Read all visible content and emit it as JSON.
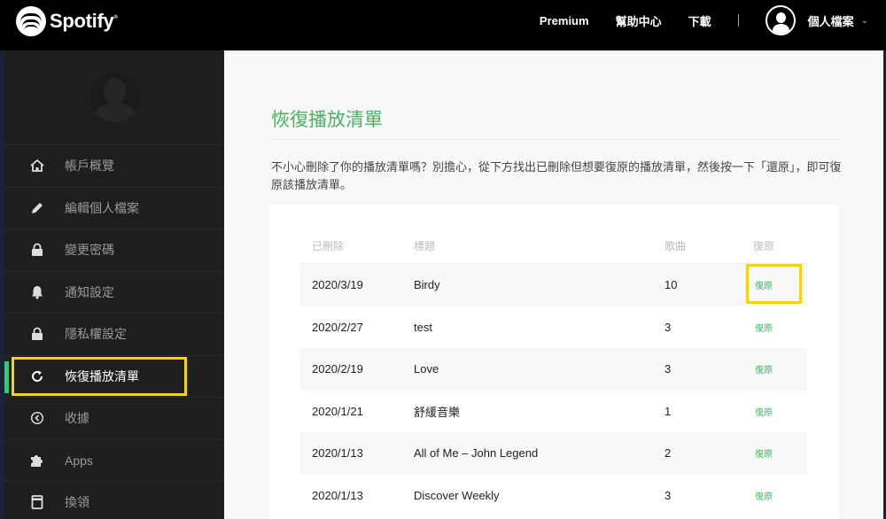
{
  "header": {
    "brand": "Spotify",
    "nav": [
      {
        "label": "Premium"
      },
      {
        "label": "幫助中心"
      },
      {
        "label": "下載"
      }
    ],
    "profile_label": "個人檔案",
    "profile_chevron": "⌄"
  },
  "sidebar": {
    "items": [
      {
        "label": "帳戶概覽",
        "icon": "home-icon",
        "glyph": "⌂"
      },
      {
        "label": "編輯個人檔案",
        "icon": "pencil-icon",
        "glyph": "✎"
      },
      {
        "label": "變更密碼",
        "icon": "lock-icon",
        "glyph": "🔒"
      },
      {
        "label": "通知設定",
        "icon": "bell-icon",
        "glyph": "🔔"
      },
      {
        "label": "隱私權設定",
        "icon": "lock-icon",
        "glyph": "🔒"
      },
      {
        "label": "恢復播放清單",
        "icon": "refresh-icon",
        "glyph": "⟳",
        "active": true
      },
      {
        "label": "收據",
        "icon": "clock-back-icon",
        "glyph": "⊙"
      },
      {
        "label": "Apps",
        "icon": "puzzle-icon",
        "glyph": "✚"
      },
      {
        "label": "換領",
        "icon": "card-icon",
        "glyph": "▭"
      }
    ]
  },
  "main": {
    "title": "恢復播放清單",
    "description": "不小心刪除了你的播放清單嗎？別擔心，從下方找出已刪除但想要復原的播放清單，然後按一下「還原」，即可復原該播放清單。",
    "table": {
      "headers": {
        "deleted": "已刪除",
        "title": "標題",
        "songs": "歌曲",
        "restore": "復原"
      },
      "rows": [
        {
          "deleted": "2020/3/19",
          "title": "Birdy",
          "songs": "10",
          "restore": "復原"
        },
        {
          "deleted": "2020/2/27",
          "title": "test",
          "songs": "3",
          "restore": "復原"
        },
        {
          "deleted": "2020/2/19",
          "title": "Love",
          "songs": "3",
          "restore": "復原"
        },
        {
          "deleted": "2020/1/21",
          "title": "舒緩音樂",
          "songs": "1",
          "restore": "復原"
        },
        {
          "deleted": "2020/1/13",
          "title": "All of Me – John Legend",
          "songs": "2",
          "restore": "復原"
        },
        {
          "deleted": "2020/1/13",
          "title": "Discover Weekly",
          "songs": "3",
          "restore": "復原"
        }
      ]
    }
  },
  "colors": {
    "accent_green": "#1ed760",
    "title_green": "#4caf62",
    "highlight_yellow": "#f7d117"
  }
}
